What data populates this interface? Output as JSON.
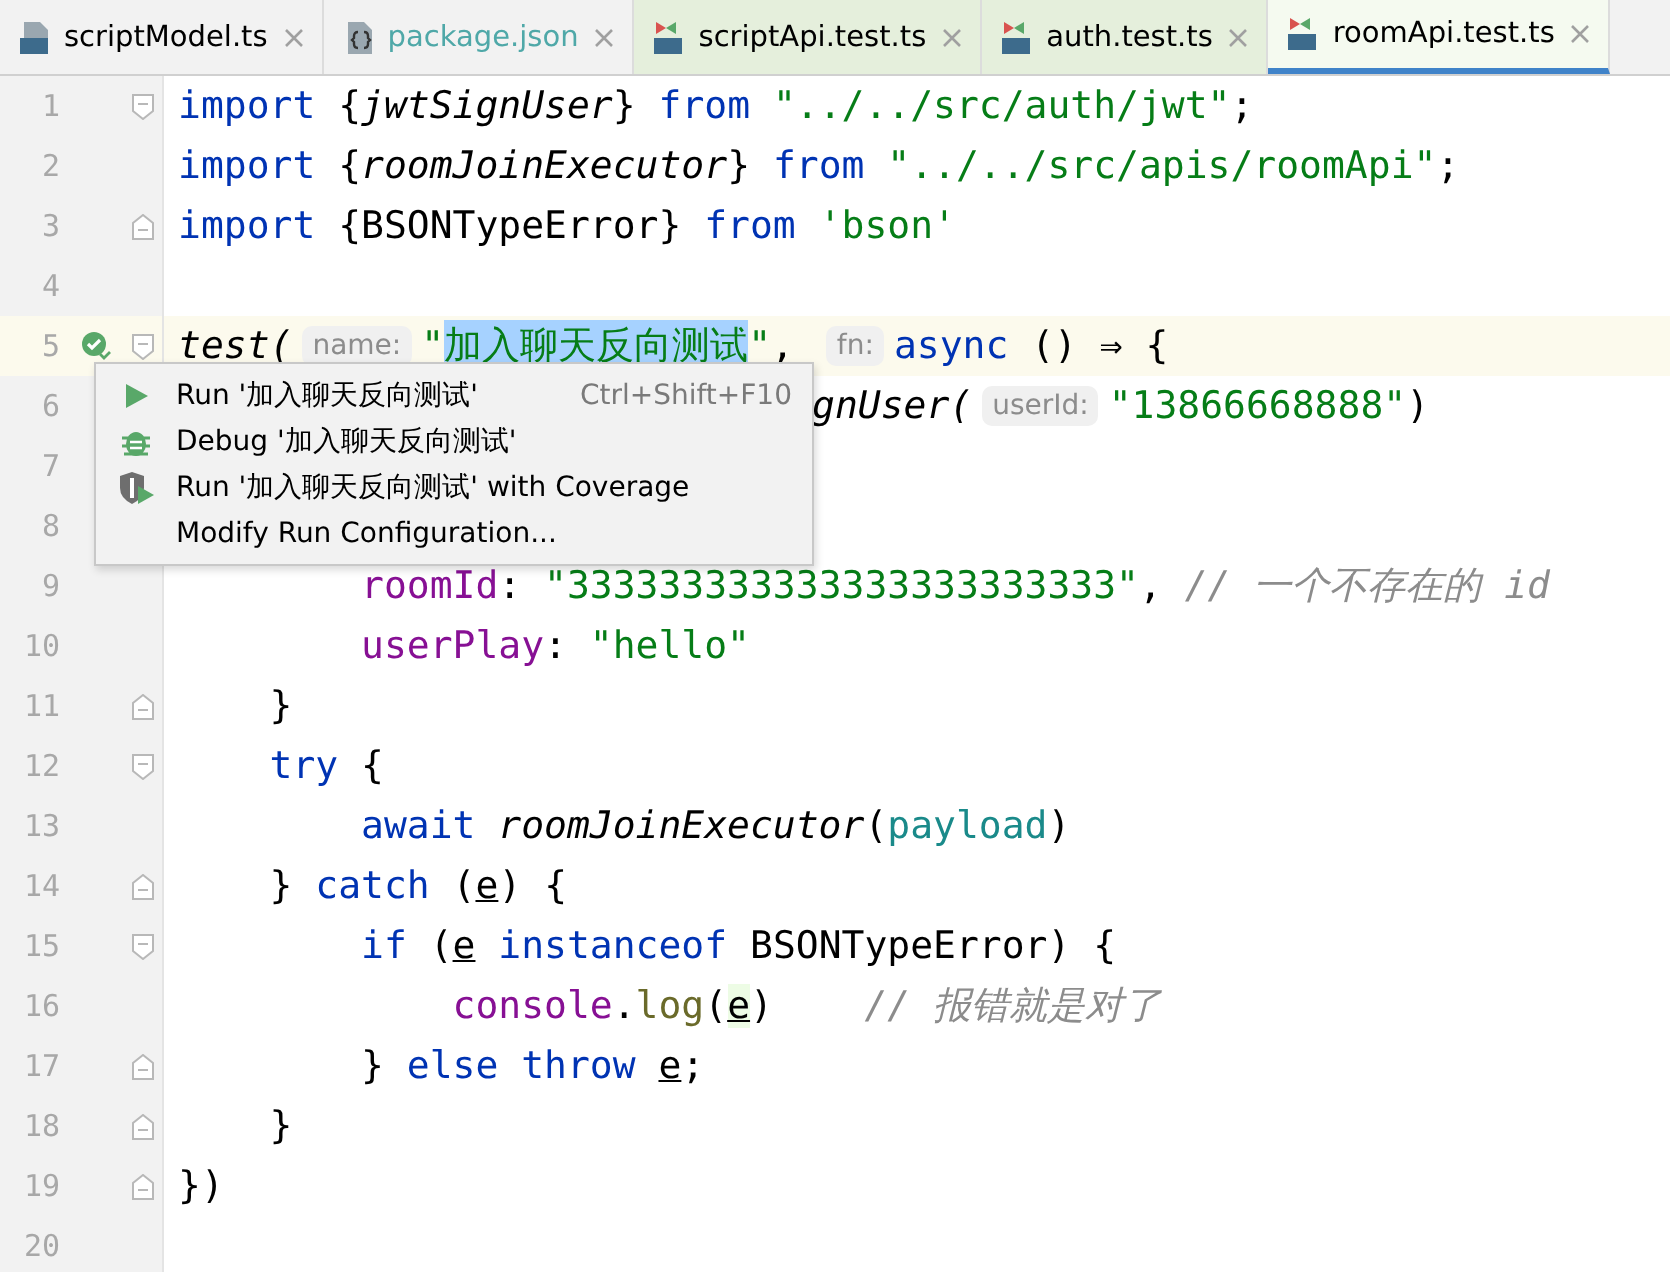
{
  "tabs": [
    {
      "label": "scriptModel.ts",
      "kind": "ts",
      "selected": false,
      "color": "#000000"
    },
    {
      "label": "package.json",
      "kind": "json",
      "selected": false,
      "color": "#4fa8a8"
    },
    {
      "label": "scriptApi.test.ts",
      "kind": "test",
      "selected": false,
      "color": "#000000"
    },
    {
      "label": "auth.test.ts",
      "kind": "test",
      "selected": false,
      "color": "#000000"
    },
    {
      "label": "roomApi.test.ts",
      "kind": "test",
      "selected": true,
      "color": "#000000"
    }
  ],
  "editor": {
    "lines": [
      {
        "number": "1",
        "fold_start": true,
        "tokens": [
          {
            "kind": "kw",
            "t": "import"
          },
          {
            "kind": "plain",
            "t": " {"
          },
          {
            "kind": "fn",
            "t": "jwtSignUser"
          },
          {
            "kind": "plain",
            "t": "} "
          },
          {
            "kind": "kw",
            "t": "from"
          },
          {
            "kind": "str",
            "t": " \"../../src/auth/jwt\""
          },
          {
            "kind": "plain",
            "t": ";"
          }
        ]
      },
      {
        "number": "2",
        "tokens": [
          {
            "kind": "kw",
            "t": "import"
          },
          {
            "kind": "plain",
            "t": " {"
          },
          {
            "kind": "fn",
            "t": "roomJoinExecutor"
          },
          {
            "kind": "plain",
            "t": "} "
          },
          {
            "kind": "kw",
            "t": "from"
          },
          {
            "kind": "str",
            "t": " \"../../src/apis/roomApi\""
          },
          {
            "kind": "plain",
            "t": ";"
          }
        ]
      },
      {
        "number": "3",
        "fold_end": true,
        "tokens": [
          {
            "kind": "kw",
            "t": "import"
          },
          {
            "kind": "plain",
            "t": " {BSONTypeError} "
          },
          {
            "kind": "kw",
            "t": "from"
          },
          {
            "kind": "str",
            "t": " 'bson'"
          }
        ]
      },
      {
        "number": "4"
      },
      {
        "number": "5",
        "fold_start": true,
        "current": true,
        "passed": true,
        "tokens": [
          {
            "kind": "fn",
            "t": "test("
          },
          {
            "kind": "hint",
            "t": "name:"
          },
          {
            "kind": "str",
            "t": "\""
          },
          {
            "kind": "sel",
            "t": "加入聊天反向测试"
          },
          {
            "kind": "str",
            "t": "\""
          },
          {
            "kind": "plain",
            "t": ", "
          },
          {
            "kind": "hint",
            "t": "fn:"
          },
          {
            "kind": "kw",
            "t": "async"
          },
          {
            "kind": "plain",
            "t": " () ⇒ {"
          }
        ]
      },
      {
        "number": "6",
        "partial": true,
        "tokens": [
          {
            "kind": "fn",
            "t": "gnUser("
          },
          {
            "kind": "hint",
            "t": "userId:"
          },
          {
            "kind": "str",
            "t": "\"13866668888\""
          },
          {
            "kind": "plain",
            "t": ")"
          }
        ]
      },
      {
        "number": "7"
      },
      {
        "number": "8"
      },
      {
        "number": "9",
        "tokens": [
          {
            "kind": "prop",
            "t": "        roomId"
          },
          {
            "kind": "plain",
            "t": ": "
          },
          {
            "kind": "str",
            "t": "\"333333333333333333333333\""
          },
          {
            "kind": "plain",
            "t": ", "
          },
          {
            "kind": "comment",
            "t": "// 一个不存在的 id"
          }
        ]
      },
      {
        "number": "10",
        "tokens": [
          {
            "kind": "prop",
            "t": "        userPlay"
          },
          {
            "kind": "plain",
            "t": ": "
          },
          {
            "kind": "str",
            "t": "\"hello\""
          }
        ]
      },
      {
        "number": "11",
        "fold_end": true,
        "tokens": [
          {
            "kind": "plain",
            "t": "    }"
          }
        ]
      },
      {
        "number": "12",
        "fold_start": true,
        "tokens": [
          {
            "kind": "kw",
            "t": "    try"
          },
          {
            "kind": "plain",
            "t": " {"
          }
        ]
      },
      {
        "number": "13",
        "tokens": [
          {
            "kind": "kw",
            "t": "        await"
          },
          {
            "kind": "fn",
            "t": " roomJoinExecutor"
          },
          {
            "kind": "plain",
            "t": "("
          },
          {
            "kind": "param",
            "t": "payload"
          },
          {
            "kind": "plain",
            "t": ")"
          }
        ]
      },
      {
        "number": "14",
        "fold_end": true,
        "tokens": [
          {
            "kind": "plain",
            "t": "    } "
          },
          {
            "kind": "kw",
            "t": "catch"
          },
          {
            "kind": "plain",
            "t": " ("
          },
          {
            "kind": "under",
            "t": "e"
          },
          {
            "kind": "plain",
            "t": ") {"
          }
        ]
      },
      {
        "number": "15",
        "fold_start": true,
        "tokens": [
          {
            "kind": "kw",
            "t": "        if"
          },
          {
            "kind": "plain",
            "t": " ("
          },
          {
            "kind": "under",
            "t": "e"
          },
          {
            "kind": "kw",
            "t": " instanceof"
          },
          {
            "kind": "plain",
            "t": " BSONTypeError) {"
          }
        ]
      },
      {
        "number": "16",
        "tokens": [
          {
            "kind": "prop",
            "t": "            console"
          },
          {
            "kind": "plain",
            "t": "."
          },
          {
            "kind": "method",
            "t": "log"
          },
          {
            "kind": "plain",
            "t": "("
          },
          {
            "kind": "under-hl",
            "t": "e"
          },
          {
            "kind": "plain",
            "t": ")"
          },
          {
            "kind": "comment",
            "t": "    // 报错就是对了"
          }
        ]
      },
      {
        "number": "17",
        "fold_end": true,
        "tokens": [
          {
            "kind": "plain",
            "t": "        } "
          },
          {
            "kind": "kw",
            "t": "else throw "
          },
          {
            "kind": "under",
            "t": "e"
          },
          {
            "kind": "plain",
            "t": ";"
          }
        ]
      },
      {
        "number": "18",
        "fold_end": true,
        "tokens": [
          {
            "kind": "plain",
            "t": "    }"
          }
        ]
      },
      {
        "number": "19",
        "fold_end": true,
        "tokens": [
          {
            "kind": "plain",
            "t": "})"
          }
        ]
      },
      {
        "number": "20"
      }
    ]
  },
  "context_menu": {
    "items": [
      {
        "kind": "run",
        "label": "Run '加入聊天反向测试'",
        "shortcut": "Ctrl+Shift+F10"
      },
      {
        "kind": "debug",
        "label": "Debug '加入聊天反向测试'"
      },
      {
        "kind": "coverage",
        "label": "Run '加入聊天反向测试' with Coverage"
      },
      {
        "kind": "plain",
        "label": "Modify Run Configuration..."
      }
    ]
  }
}
